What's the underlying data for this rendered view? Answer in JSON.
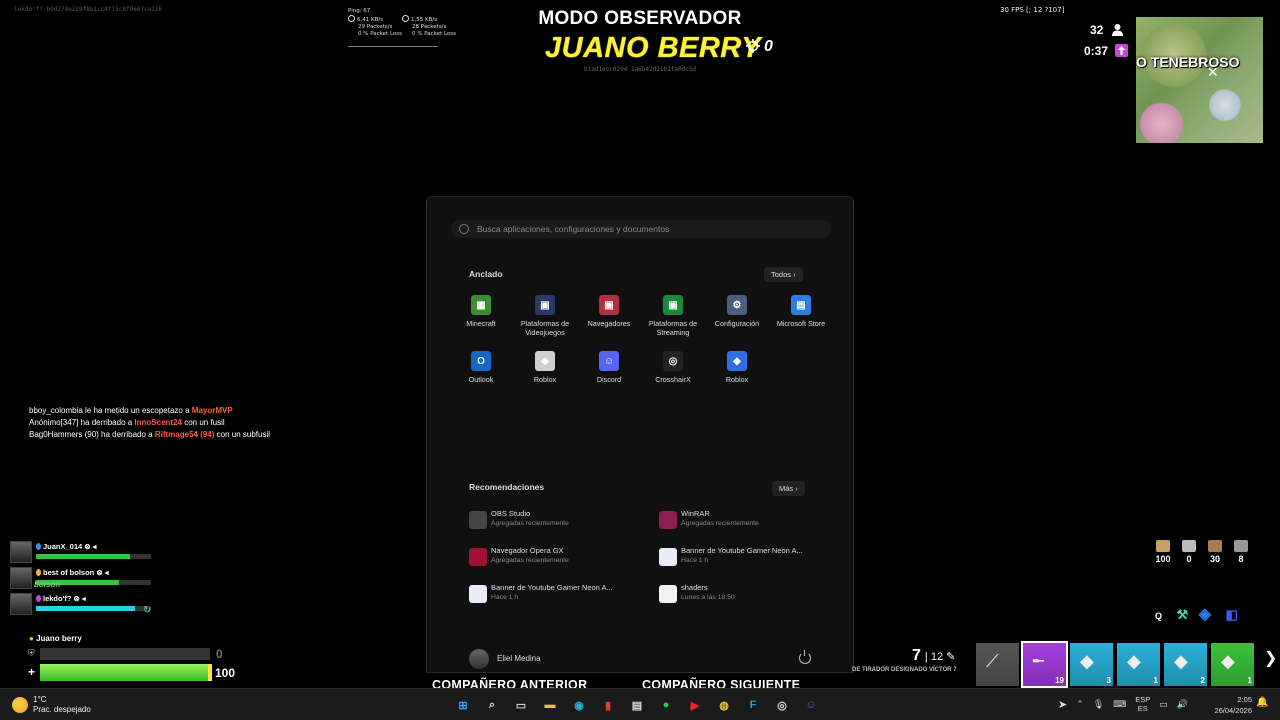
{
  "top_left": {
    "ids": "lekdo'f?   b0d278e229f8b1cc4f15c8f966?ca116"
  },
  "net": {
    "ping": "Ping: 67",
    "down_rate": "6,41 KB/s",
    "down_packets": "29 Packets/s",
    "down_loss": "0 % Packet Loss",
    "up_rate": "1,55 KB/s",
    "up_packets": "28 Packets/s",
    "up_loss": "0 % Packet Loss"
  },
  "observer": {
    "mode": "MODO OBSERVADOR",
    "name": "JUANO BERRY",
    "eliminations": "0",
    "id": "b1ad1ecc0204 1a6b42d2101fa0dc5d"
  },
  "hud": {
    "fps": "30 FPS [; 12 ?107]",
    "players_left": "32",
    "storm_timer": "0:37",
    "minimap_label": "O TENEBROSO"
  },
  "killfeed": [
    {
      "pre": "bboy_colombia le ha metido un escopetazo a ",
      "victim": "MayorMVP",
      "post": ""
    },
    {
      "pre": "Anónimo[347] ha derribado a ",
      "victim": "InnoScent24",
      "post": " con un fusil"
    },
    {
      "pre": "Bag0Hammers (90) ha derribado a ",
      "victim": "Riftmage54 (94)",
      "post": " con un subfusil"
    }
  ],
  "squad": {
    "members": [
      {
        "name": "JuanX_014",
        "health": 0.82,
        "color": "#3ac23a",
        "dot": "#3a8ef0"
      },
      {
        "name": "best of bolson",
        "health": 0.72,
        "color": "#3ac23a",
        "dot": "#f0b43a",
        "sub": "bolson"
      },
      {
        "name": "lekdo'f?",
        "health": 0.86,
        "color": "#2ad0e6",
        "dot": "#c04ad6"
      }
    ],
    "player_name": "Juano berry",
    "shield": "0",
    "health": "100",
    "health_fill": 1.0
  },
  "start_menu": {
    "search_placeholder": "Busca aplicaciones, configuraciones y documentos",
    "pinned_title": "Anclado",
    "all_button": "Todos",
    "apps": [
      {
        "label": "Minecraft",
        "icon": "minecraft-icon",
        "color": "#3b8f2e",
        "glyph": "▦"
      },
      {
        "label": "Plataformas de Videojuegos",
        "icon": "folder-icon",
        "color": "#2a3a66",
        "glyph": "▣"
      },
      {
        "label": "Navegadores",
        "icon": "folder-icon",
        "color": "#b03040",
        "glyph": "▣"
      },
      {
        "label": "Plataformas de Streaming",
        "icon": "folder-icon",
        "color": "#1a8a3a",
        "glyph": "▣"
      },
      {
        "label": "Configuración",
        "icon": "gear-icon",
        "color": "#4a5f7a",
        "glyph": "⚙"
      },
      {
        "label": "Microsoft Store",
        "icon": "store-icon",
        "color": "#2d7de0",
        "glyph": "▤"
      },
      {
        "label": "Outlook",
        "icon": "outlook-icon",
        "color": "#1468c0",
        "glyph": "O"
      },
      {
        "label": "Roblox",
        "icon": "roblox-icon",
        "color": "#cfcfcf",
        "glyph": "◆"
      },
      {
        "label": "Discord",
        "icon": "discord-icon",
        "color": "#5865f2",
        "glyph": "☺"
      },
      {
        "label": "CrosshairX",
        "icon": "crosshair-icon",
        "color": "#222222",
        "glyph": "◎"
      },
      {
        "label": "Roblox",
        "icon": "roblox-studio-icon",
        "color": "#2f6fe6",
        "glyph": "◆"
      }
    ],
    "recs_title": "Recomendaciones",
    "more_button": "Más",
    "recs": [
      {
        "name": "OBS Studio",
        "sub": "Agregadas recientemente",
        "icon": "obs-icon",
        "color": "#444444"
      },
      {
        "name": "WinRAR",
        "sub": "Agregadas recientemente",
        "icon": "winrar-icon",
        "color": "#8a2050"
      },
      {
        "name": "Navegador Opera GX",
        "sub": "Agregadas recientemente",
        "icon": "opera-gx-icon",
        "color": "#a01030"
      },
      {
        "name": "Banner de Youtube Gamer Neon A...",
        "sub": "Hace 1 h",
        "icon": "document-icon",
        "color": "#e8eef8"
      },
      {
        "name": "Banner de Youtube Gamer Neon A...",
        "sub": "Hace 1 h",
        "icon": "document-icon",
        "color": "#e8eef8"
      },
      {
        "name": "shaders",
        "sub": "Lunes a las 18:50",
        "icon": "file-icon",
        "color": "#f2f2f2"
      }
    ],
    "user": "Eliel Medina"
  },
  "inventory": {
    "mats": [
      {
        "value": "100",
        "icon": "wood-icon",
        "color": "#c7a06a"
      },
      {
        "value": "0",
        "icon": "stone-icon",
        "color": "#bbbbbb"
      },
      {
        "value": "30",
        "icon": "brick-icon",
        "color": "#a87a58"
      },
      {
        "value": "8",
        "icon": "metal-icon",
        "color": "#999999"
      }
    ],
    "build_key": "Q",
    "ammo_mag": "7",
    "ammo_reserve": "12",
    "weapon_name": "DE TIRADOR DESIGNADO VÍCTOR 7",
    "slots": [
      {
        "icon": "pickaxe-icon",
        "color": "#555555",
        "count": ""
      },
      {
        "icon": "rifle-icon",
        "color": "#a43de0",
        "count": "19"
      },
      {
        "icon": "item-icon",
        "color": "#2ab0d8",
        "count": "3"
      },
      {
        "icon": "item-icon",
        "color": "#2ab0d8",
        "count": "1"
      },
      {
        "icon": "item-icon",
        "color": "#2ab0d8",
        "count": "2"
      },
      {
        "icon": "item-icon",
        "color": "#3ac23a",
        "count": "1"
      }
    ],
    "prev_teammate": "COMPAÑERO ANTERIOR",
    "next_teammate": "COMPAÑERO SIGUIENTE"
  },
  "taskbar": {
    "temp": "1°C",
    "weather": "Prac. despejado",
    "apps": [
      {
        "icon": "windows-start-icon",
        "color": "#3aa0ff",
        "glyph": "⊞"
      },
      {
        "icon": "search-icon",
        "color": "#dddddd",
        "glyph": "⌕"
      },
      {
        "icon": "task-view-icon",
        "color": "#cccccc",
        "glyph": "▭"
      },
      {
        "icon": "file-explorer-icon",
        "color": "#f0c040",
        "glyph": "▬"
      },
      {
        "icon": "edge-icon",
        "color": "#2ab0d8",
        "glyph": "◉"
      },
      {
        "icon": "office-icon",
        "color": "#e04030",
        "glyph": "▮"
      },
      {
        "icon": "store-icon",
        "color": "#dddddd",
        "glyph": "▤"
      },
      {
        "icon": "spotify-icon",
        "color": "#1ed760",
        "glyph": "●"
      },
      {
        "icon": "youtube-icon",
        "color": "#ff2020",
        "glyph": "▶"
      },
      {
        "icon": "chrome-icon",
        "color": "#f0c030",
        "glyph": "◍"
      },
      {
        "icon": "fortnite-icon",
        "color": "#2a9ad8",
        "glyph": "F"
      },
      {
        "icon": "crosshair-icon",
        "color": "#dddddd",
        "glyph": "◎"
      },
      {
        "icon": "discord-icon",
        "color": "#5865f2",
        "glyph": "☺"
      }
    ],
    "lang": "ESP",
    "lang_sub": "ES",
    "time": "2:05",
    "date": "26/04/2026"
  }
}
